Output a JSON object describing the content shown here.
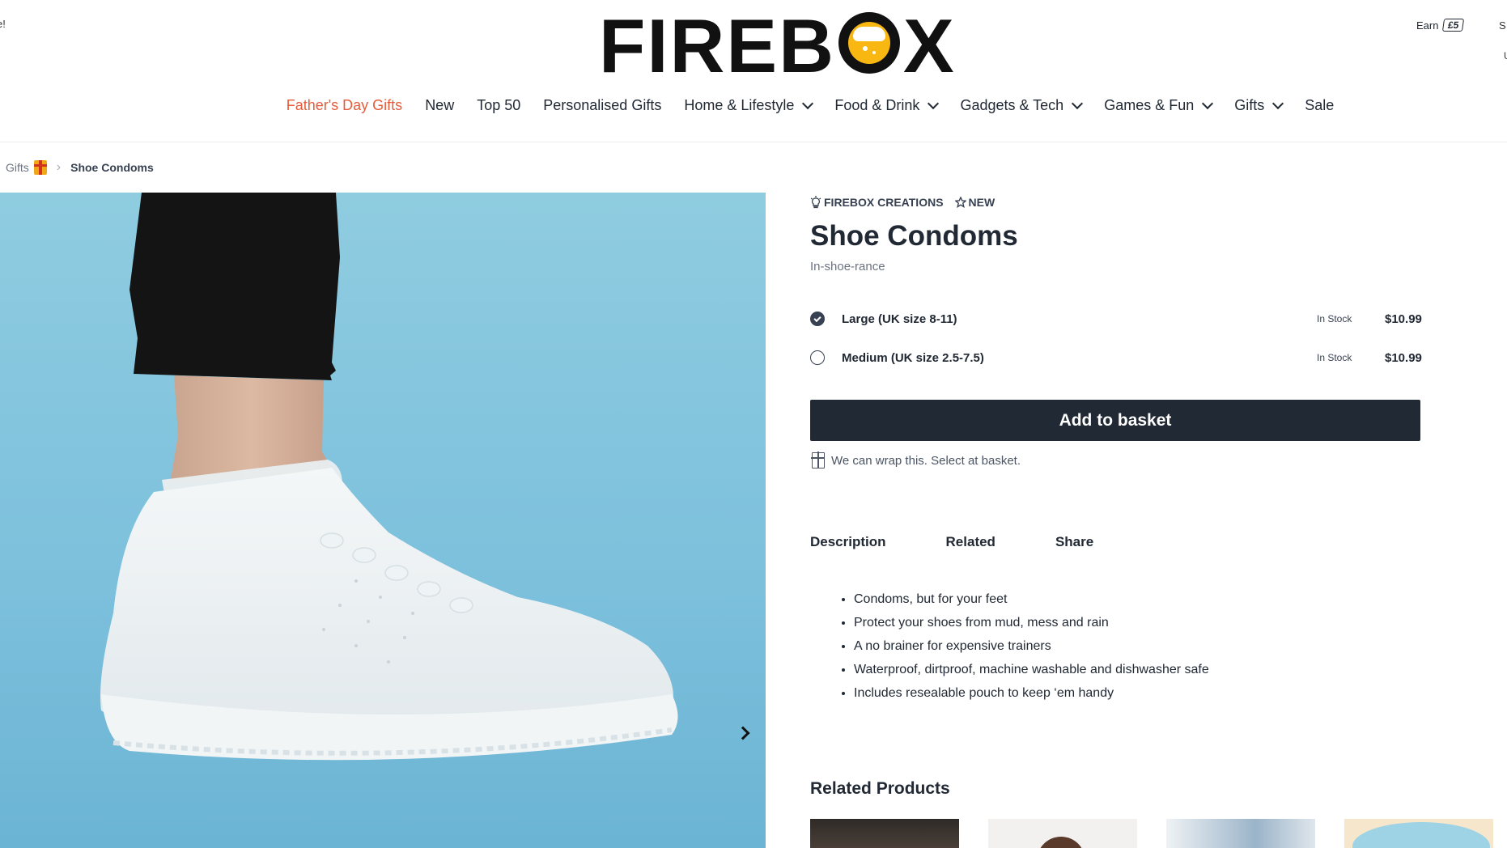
{
  "header": {
    "edge_left_text": "e!",
    "edge_right_top_text": "S",
    "edge_right_mid_text": "U",
    "earn_label": "Earn",
    "earn_amount": "£5",
    "logo_text_left": "FIREB",
    "logo_text_right": "X"
  },
  "nav": {
    "items": [
      {
        "label": "Father's Day Gifts"
      },
      {
        "label": "New"
      },
      {
        "label": "Top 50"
      },
      {
        "label": "Personalised Gifts"
      },
      {
        "label": "Home & Lifestyle"
      },
      {
        "label": "Food & Drink"
      },
      {
        "label": "Gadgets & Tech"
      },
      {
        "label": "Games & Fun"
      },
      {
        "label": "Gifts"
      },
      {
        "label": "Sale"
      }
    ]
  },
  "breadcrumb": {
    "parent": "Gifts",
    "current": "Shoe Condoms"
  },
  "product": {
    "badge_creations": "FIREBOX CREATIONS",
    "badge_new": "NEW",
    "title": "Shoe Condoms",
    "subtitle": "In-shoe-rance",
    "options": [
      {
        "label": "Large (UK size 8-11)",
        "stock": "In Stock",
        "price": "$10.99",
        "selected": true
      },
      {
        "label": "Medium (UK size 2.5-7.5)",
        "stock": "In Stock",
        "price": "$10.99",
        "selected": false
      }
    ],
    "basket_label": "Add to basket",
    "wrap_note": "We can wrap this. Select at basket."
  },
  "tabs": {
    "description": "Description",
    "related": "Related",
    "share": "Share"
  },
  "description": {
    "bullets": [
      "Condoms, but for your feet",
      "Protect your shoes from mud, mess and rain",
      "A no brainer for expensive trainers",
      "Waterproof, dirtproof, machine washable and dishwasher safe",
      "Includes resealable pouch to keep ‘em handy"
    ]
  },
  "related": {
    "heading": "Related Products"
  },
  "colors": {
    "accent": "#e55c3a",
    "dark": "#212934",
    "image_bg": "#8fcce0"
  }
}
